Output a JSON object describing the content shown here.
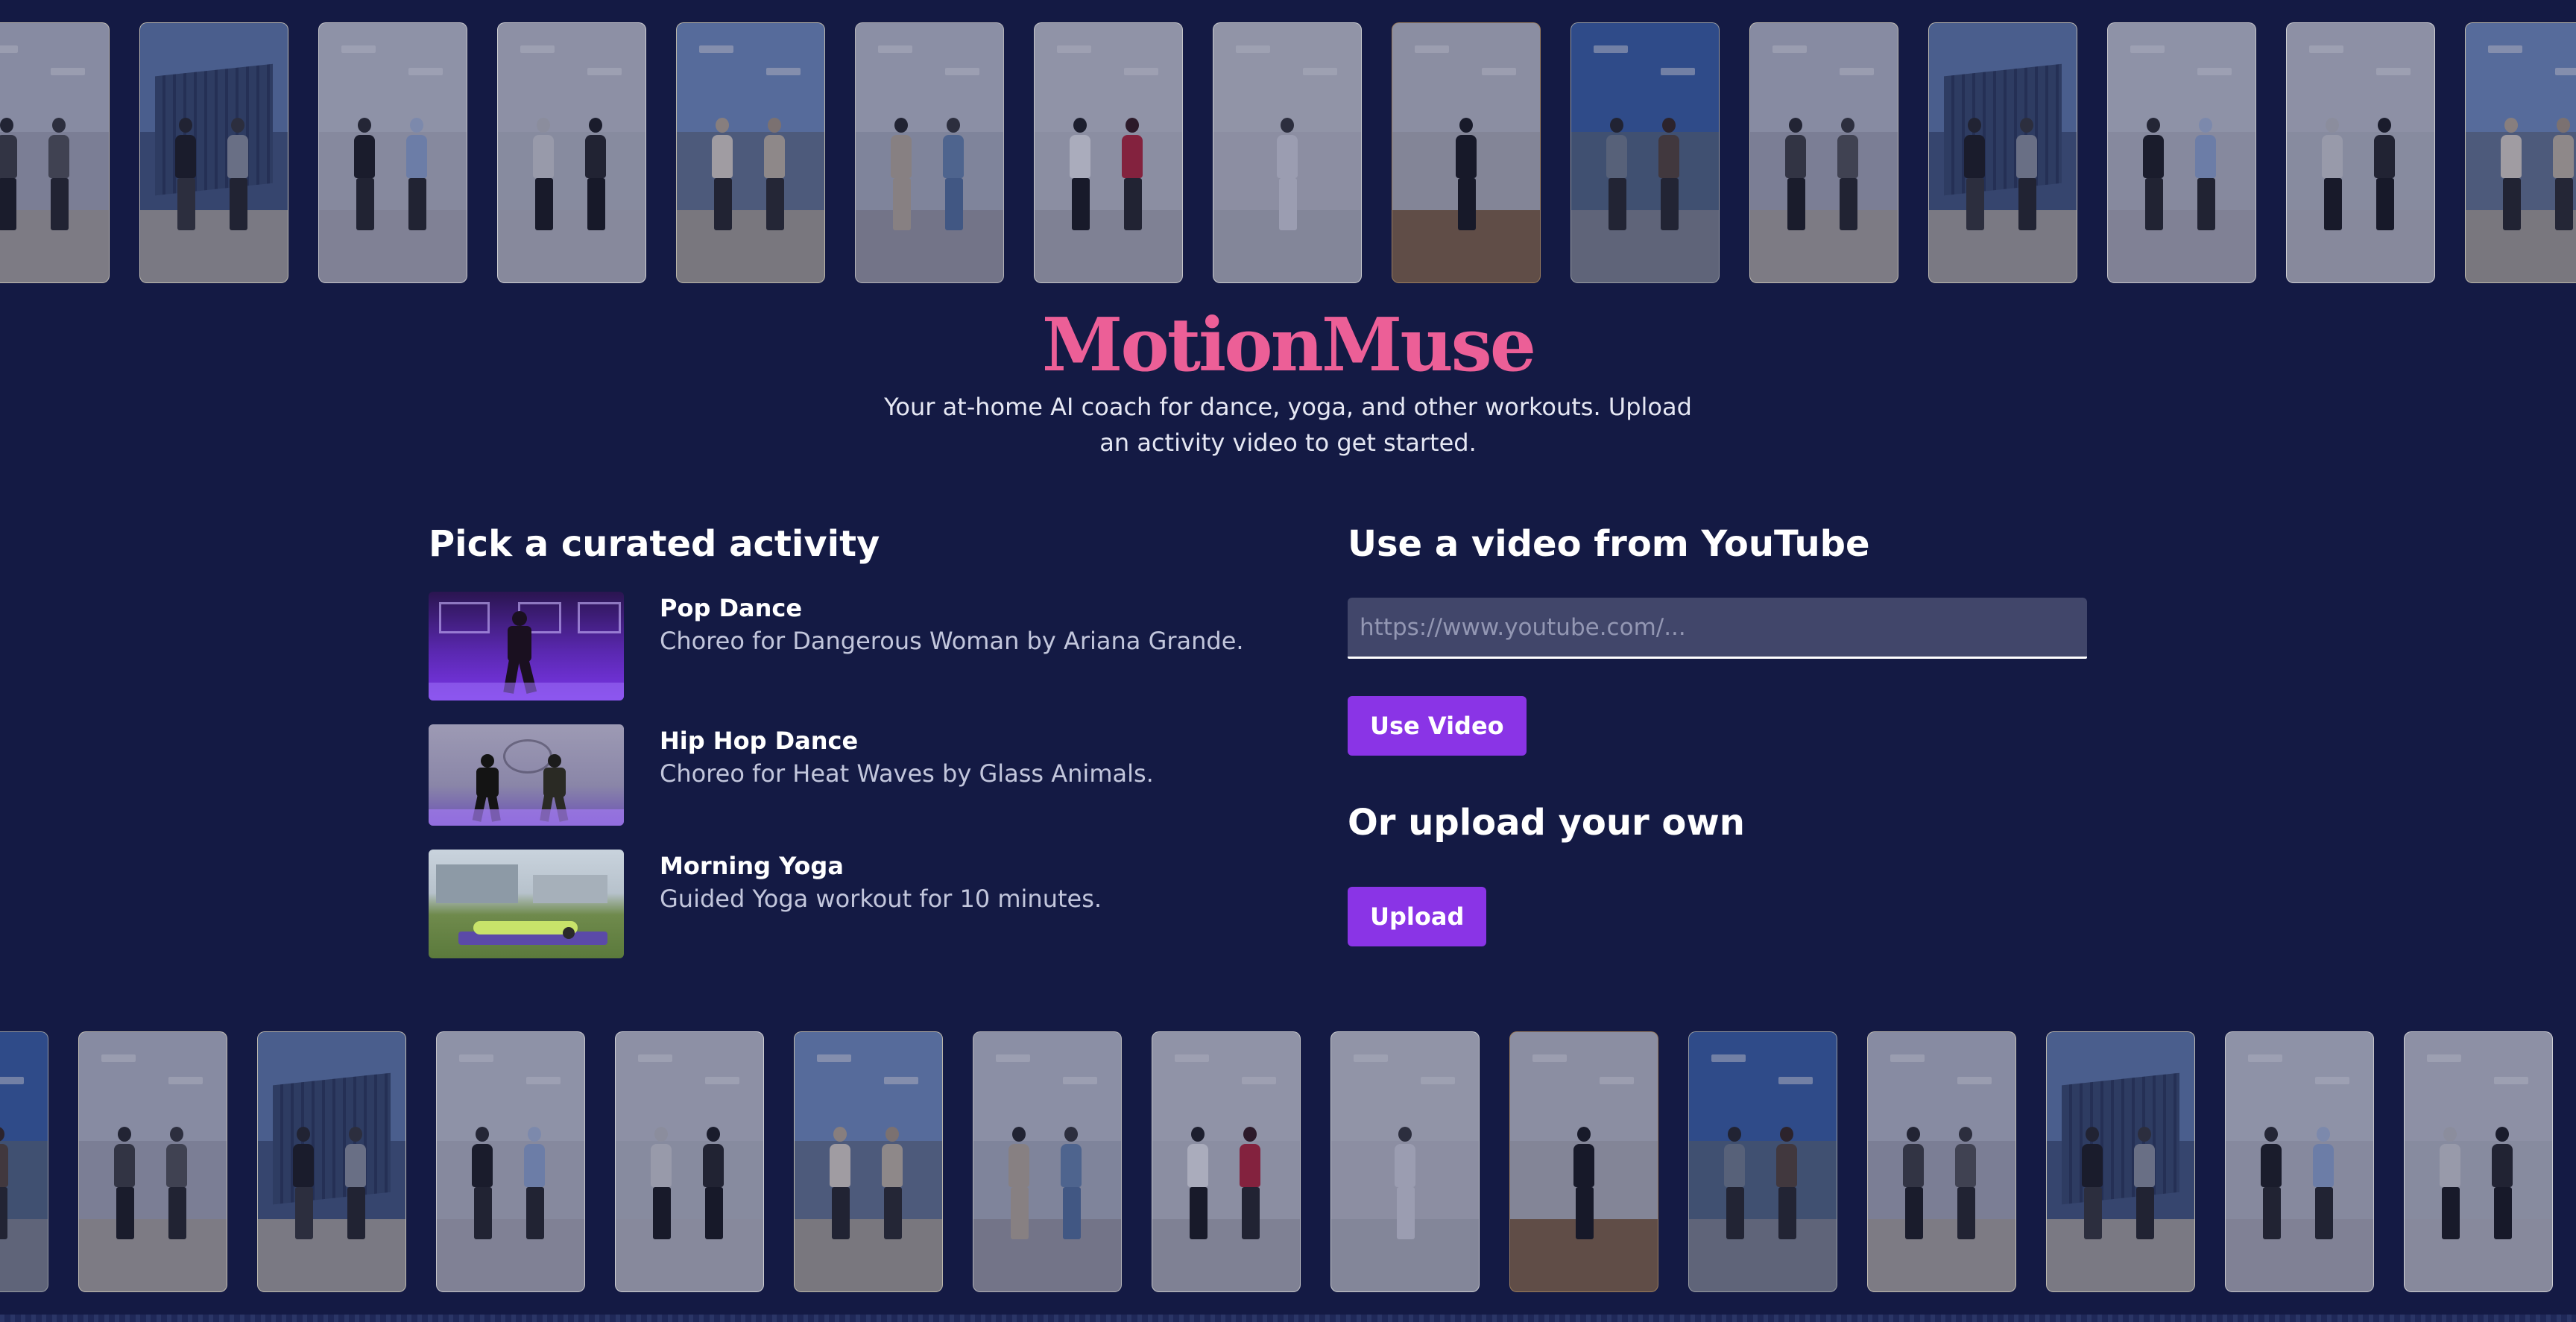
{
  "brand": {
    "name": "MotionMuse",
    "tagline": "Your at-home AI coach for dance, yoga, and other workouts. Upload an activity video to get started."
  },
  "curated": {
    "heading": "Pick a curated activity",
    "items": [
      {
        "name": "Pop Dance",
        "description": "Choreo for Dangerous Woman by Ariana Grande."
      },
      {
        "name": "Hip Hop Dance",
        "description": "Choreo for Heat Waves by Glass Animals."
      },
      {
        "name": "Morning Yoga",
        "description": "Guided Yoga workout for 10 minutes."
      }
    ]
  },
  "youtube": {
    "heading": "Use a video from YouTube",
    "placeholder": "https://www.youtube.com/...",
    "value": "",
    "button_label": "Use Video"
  },
  "upload": {
    "heading": "Or upload your own",
    "button_label": "Upload"
  },
  "colors": {
    "background": "#141a44",
    "brand": "#ec5f97",
    "button": "#8a34e6",
    "input_bg": "#41466a"
  }
}
